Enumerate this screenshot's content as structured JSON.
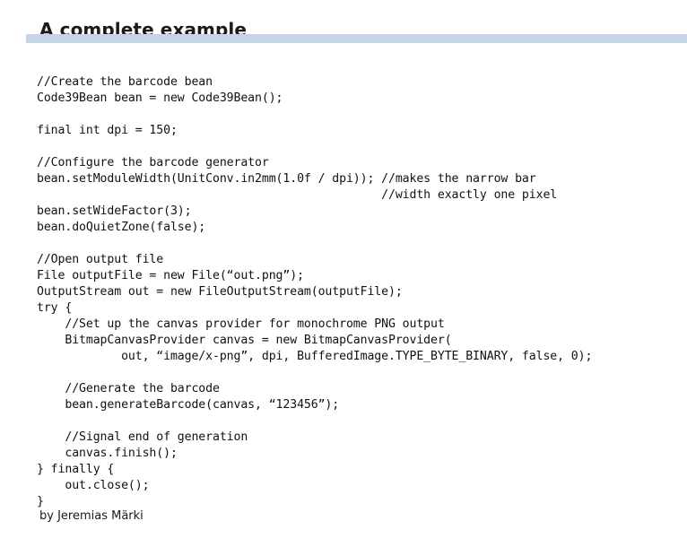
{
  "slide": {
    "title": "A complete example",
    "author": "by Jeremias Märki",
    "accent_color": "#c6d4e7",
    "text_color": "#111111",
    "background_color": "#ffffff"
  },
  "code": {
    "language": "java",
    "lines": [
      "//Create the barcode bean",
      "Code39Bean bean = new Code39Bean();",
      "",
      "final int dpi = 150;",
      "",
      "//Configure the barcode generator",
      "bean.setModuleWidth(UnitConv.in2mm(1.0f / dpi)); //makes the narrow bar",
      "                                                 //width exactly one pixel",
      "bean.setWideFactor(3);",
      "bean.doQuietZone(false);",
      "",
      "//Open output file",
      "File outputFile = new File(“out.png”);",
      "OutputStream out = new FileOutputStream(outputFile);",
      "try {",
      "    //Set up the canvas provider for monochrome PNG output",
      "    BitmapCanvasProvider canvas = new BitmapCanvasProvider(",
      "            out, “image/x-png”, dpi, BufferedImage.TYPE_BYTE_BINARY, false, 0);",
      "",
      "    //Generate the barcode",
      "    bean.generateBarcode(canvas, “123456”);",
      "",
      "    //Signal end of generation",
      "    canvas.finish();",
      "} finally {",
      "    out.close();",
      "}"
    ]
  }
}
